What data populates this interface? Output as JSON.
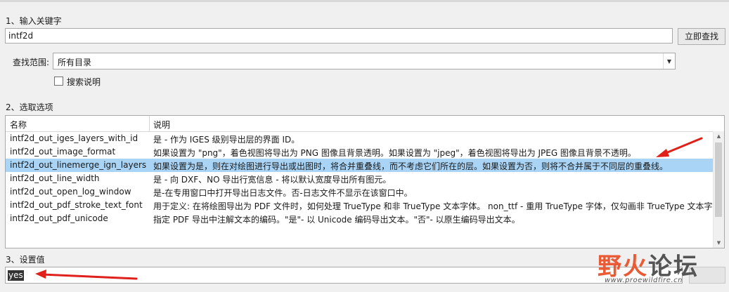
{
  "section1": {
    "label": "1、输入关键字"
  },
  "search": {
    "value": "intf2d",
    "button": "立即查找"
  },
  "scope": {
    "label": "查找范围:",
    "value": "所有目录"
  },
  "search_desc": {
    "label": "搜索说明",
    "checked": false
  },
  "section2": {
    "label": "2、选取选项"
  },
  "table": {
    "headers": [
      "名称",
      "说明"
    ],
    "rows": [
      {
        "name": "intf2d_out_iges_layers_with_id",
        "desc": "是 - 作为 IGES 级别导出层的界面 ID。"
      },
      {
        "name": "intf2d_out_image_format",
        "desc": "如果设置为 \"png\"，着色视图将导出为 PNG 图像且背景透明。如果设置为 \"jpeg\"，着色视图将导出为 JPEG 图像且背景不透明。"
      },
      {
        "name": "intf2d_out_linemerge_ign_layers",
        "desc": "如果设置为是，则在对绘图进行导出或出图时，将合并重叠线，而不考虑它们所在的层。如果设置为否，则将不合并属于不同层的重叠线。",
        "selected": true
      },
      {
        "name": "intf2d_out_line_width",
        "desc": "是 - 向 DXF、NO 导出行宽信息 - 将以默认宽度导出所有图元。"
      },
      {
        "name": "intf2d_out_open_log_window",
        "desc": "是-在专用窗口中打开导出日志文件。否-日志文件不显示在该窗口中。"
      },
      {
        "name": "intf2d_out_pdf_stroke_text_font",
        "desc": "用于定义: 在将绘图导出为 PDF 文件时，如何处理 TrueType 和非 TrueType 文本字体。 non_ttf - 重用 TrueType 字体，仅勾画非 TrueType 文本字"
      },
      {
        "name": "intf2d_out_pdf_unicode",
        "desc": "指定 PDF 导出中注解文本的编码。\"是\"- 以 Unicode 编码导出文本。\"否\"- 以原生编码导出文本。"
      }
    ]
  },
  "section3": {
    "label": "3、设置值"
  },
  "value": {
    "current": "yes"
  },
  "watermark": {
    "title_a": "野火",
    "title_b": "论坛",
    "url": "www.proewildfire.cn"
  },
  "colors": {
    "selected_row": "#a9d4f5",
    "annotation_red": "#e0201b",
    "watermark_orange": "#e95a35"
  }
}
